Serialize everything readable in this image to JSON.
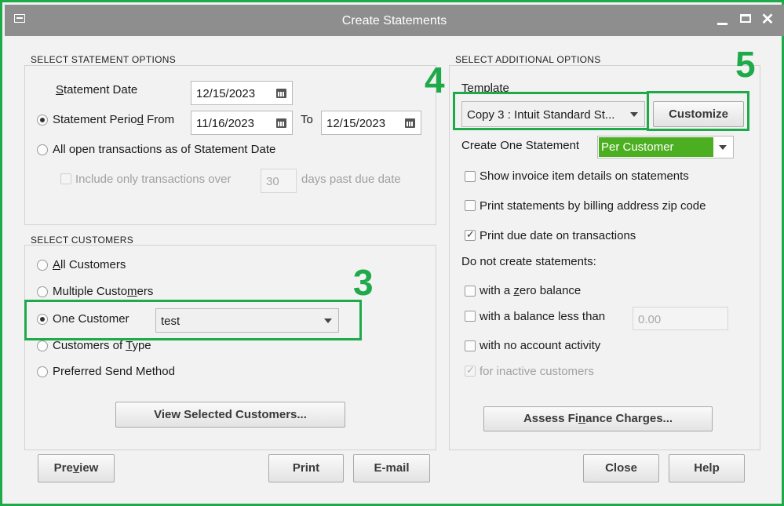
{
  "window": {
    "title": "Create Statements",
    "controls": [
      "minimize",
      "maximize",
      "close"
    ]
  },
  "statement_options": {
    "title": "SELECT STATEMENT OPTIONS",
    "statement_date_label": "Statement Date",
    "statement_date": "12/15/2023",
    "period_label": "Statement Period From",
    "period_from": "11/16/2023",
    "to_label": "To",
    "period_to": "12/15/2023",
    "all_open_label": "All open transactions as of Statement Date",
    "include_only_label": "Include only transactions over",
    "days_value": "30",
    "days_label": "days past due date",
    "selected": "Statement Period From"
  },
  "customers": {
    "title": "SELECT CUSTOMERS",
    "options": [
      "All Customers",
      "Multiple Customers",
      "One Customer",
      "Customers of Type",
      "Preferred Send Method"
    ],
    "selected": "One Customer",
    "one_customer_value": "test",
    "view_button": "View Selected Customers..."
  },
  "additional_options": {
    "title": "SELECT ADDITIONAL OPTIONS",
    "template_label": "Template",
    "template_value": "Copy 3 : Intuit Standard St...",
    "customize_button": "Customize",
    "create_one_label": "Create One Statement",
    "create_one_value": "Per Customer",
    "create_one_color": "#4caf21",
    "show_invoice_label": "Show invoice item details on statements",
    "print_zip_label": "Print statements by billing address zip code",
    "print_due_label": "Print due date on transactions",
    "do_not_create_label": "Do not create statements:",
    "zero_balance_label": "with a zero balance",
    "balance_less_label": "with a balance less than",
    "balance_less_value": "0.00",
    "no_activity_label": "with no account activity",
    "inactive_label": "for inactive customers",
    "checked": [
      "Print due date on transactions",
      "for inactive customers"
    ],
    "assess_button": "Assess Finance Charges..."
  },
  "footer": {
    "preview": "Preview",
    "print": "Print",
    "email": "E-mail",
    "close": "Close",
    "help": "Help"
  },
  "annotations": {
    "color": "#1faa4a",
    "step3": "3",
    "step4": "4",
    "step5": "5"
  }
}
